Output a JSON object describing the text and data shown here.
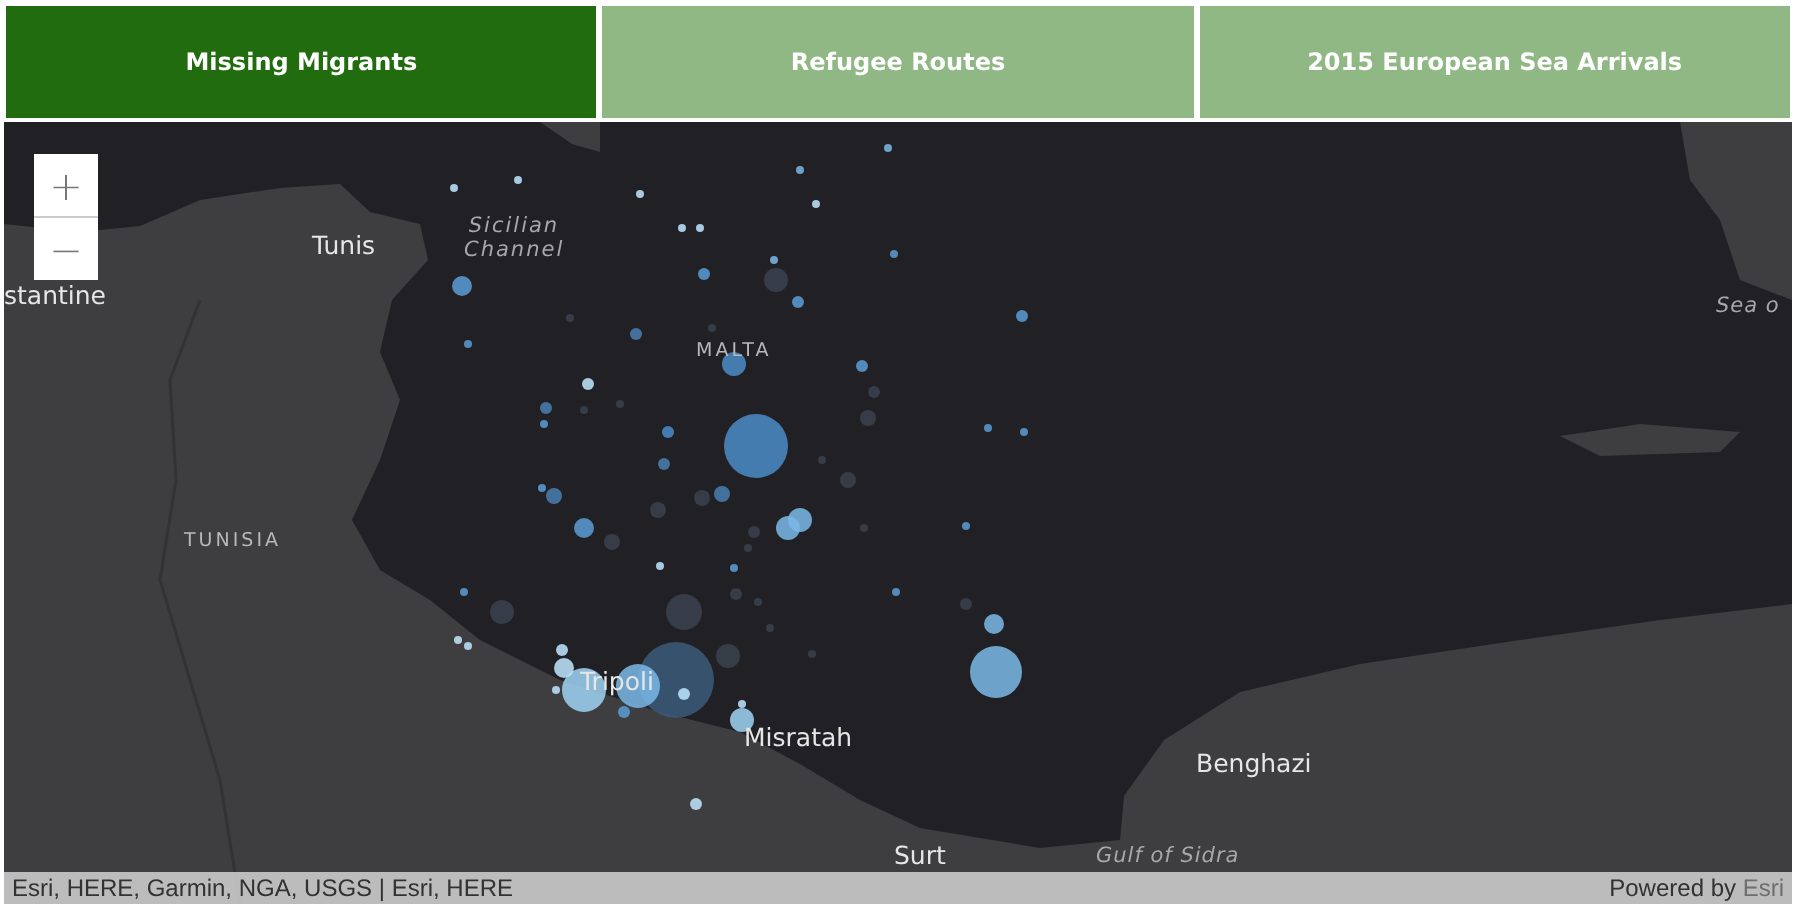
{
  "tabs": [
    {
      "label": "Missing Migrants",
      "selected": true
    },
    {
      "label": "Refugee Routes",
      "selected": false
    },
    {
      "label": "2015 European Sea Arrivals",
      "selected": false
    }
  ],
  "map": {
    "zoom_controls": [
      "+",
      "−"
    ],
    "labels": [
      {
        "text": "Tunis",
        "kind": "city"
      },
      {
        "text": "Sicilian Channel",
        "kind": "water"
      },
      {
        "text": "stantine",
        "kind": "city"
      },
      {
        "text": "MALTA",
        "kind": "country"
      },
      {
        "text": "Sea o",
        "kind": "water"
      },
      {
        "text": "TUNISIA",
        "kind": "country"
      },
      {
        "text": "Tripoli",
        "kind": "city"
      },
      {
        "text": "Misratah",
        "kind": "city"
      },
      {
        "text": "Benghazi",
        "kind": "city"
      },
      {
        "text": "Surt",
        "kind": "city"
      },
      {
        "text": "Gulf of Sidra",
        "kind": "water"
      }
    ],
    "attribution": "Esri, HERE, Garmin, NGA, USGS | Esri, HERE",
    "powered_by": "Powered by",
    "powered_link": "Esri"
  }
}
